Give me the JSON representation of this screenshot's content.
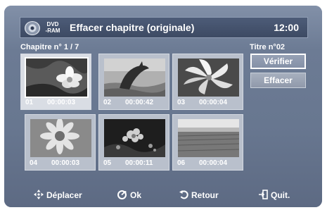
{
  "header": {
    "disc_line1": "DVD",
    "disc_line2": "-RAM",
    "title": "Effacer chapitre (originale)",
    "time": "12:00"
  },
  "chapter_label": "Chapitre n° 1 / 7",
  "title_label": "Titre n°02",
  "thumbnails": [
    {
      "num": "01",
      "time": "00:00:03",
      "icon": "white-flower-bw",
      "selected": true
    },
    {
      "num": "02",
      "time": "00:00:42",
      "icon": "dolphin-bw",
      "selected": false
    },
    {
      "num": "03",
      "time": "00:00:04",
      "icon": "lily-flower-bw",
      "selected": false
    },
    {
      "num": "04",
      "time": "00:00:03",
      "icon": "daisy-flower-bw",
      "selected": false
    },
    {
      "num": "05",
      "time": "00:00:11",
      "icon": "flowers-dark-bw",
      "selected": false
    },
    {
      "num": "06",
      "time": "00:00:04",
      "icon": "grass-field-bw",
      "selected": false
    }
  ],
  "buttons": {
    "verify": "Vérifier",
    "erase": "Effacer"
  },
  "footer": {
    "move": "Déplacer",
    "ok": "Ok",
    "back": "Retour",
    "quit": "Quit."
  }
}
